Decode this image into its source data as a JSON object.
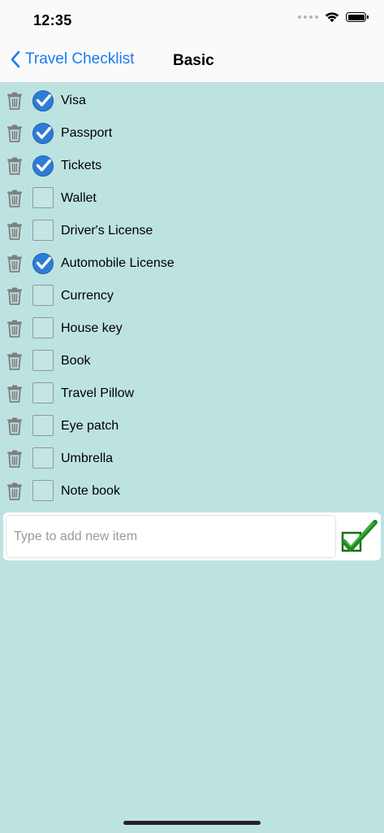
{
  "status_bar": {
    "time": "12:35"
  },
  "nav": {
    "back_label": "Travel Checklist",
    "title": "Basic"
  },
  "items": [
    {
      "label": "Visa",
      "checked": true
    },
    {
      "label": "Passport",
      "checked": true
    },
    {
      "label": "Tickets",
      "checked": true
    },
    {
      "label": "Wallet",
      "checked": false
    },
    {
      "label": "Driver's License",
      "checked": false
    },
    {
      "label": "Automobile License",
      "checked": true
    },
    {
      "label": "Currency",
      "checked": false
    },
    {
      "label": "House key",
      "checked": false
    },
    {
      "label": "Book",
      "checked": false
    },
    {
      "label": "Travel Pillow",
      "checked": false
    },
    {
      "label": "Eye patch",
      "checked": false
    },
    {
      "label": "Umbrella",
      "checked": false
    },
    {
      "label": "Note book",
      "checked": false
    }
  ],
  "add_item": {
    "placeholder": "Type to add new item",
    "value": ""
  },
  "colors": {
    "background": "#bde3e0",
    "accent": "#1a7bf0",
    "checked_circle": "#2f7cd6",
    "add_check": "#1e8a1e"
  },
  "icons": {
    "delete": "trash-icon",
    "checked": "checkmark-circle-icon",
    "unchecked": "empty-checkbox-icon",
    "add": "green-checkmark-icon",
    "back": "chevron-left-icon"
  }
}
